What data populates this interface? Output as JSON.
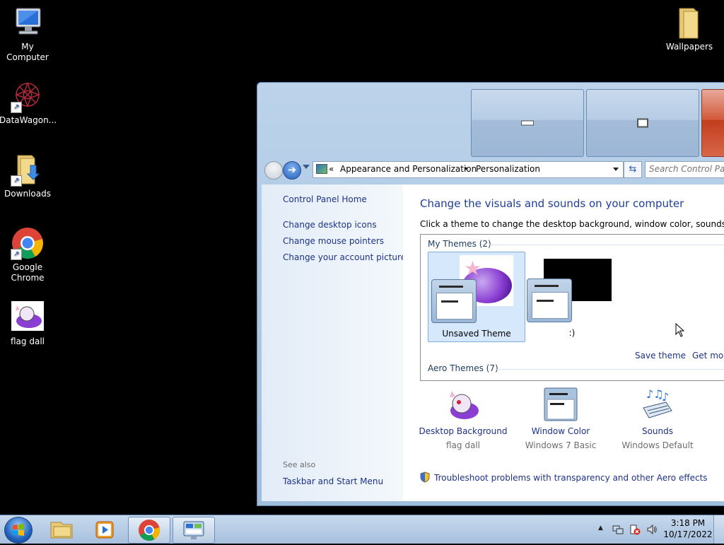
{
  "desktop": {
    "icons": [
      {
        "label": "My Computer",
        "icon": "computer-icon"
      },
      {
        "label": "DataWagon...",
        "icon": "datawagon-icon"
      },
      {
        "label": "Downloads",
        "icon": "folder-download-icon"
      },
      {
        "label": "Google Chrome",
        "icon": "chrome-icon"
      },
      {
        "label": "flag dall",
        "icon": "image-icon"
      },
      {
        "label": "Wallpapers",
        "icon": "folder-icon"
      }
    ]
  },
  "window": {
    "address": {
      "chevron": "«",
      "crumb1": "Appearance and Personalization",
      "separator": "▸",
      "crumb2": "Personalization"
    },
    "search": {
      "placeholder": "Search Control Panel"
    },
    "sidebar": {
      "home": "Control Panel Home",
      "links": [
        "Change desktop icons",
        "Change mouse pointers",
        "Change your account picture"
      ],
      "see_also": "See also",
      "see_also_links": [
        "Taskbar and Start Menu"
      ]
    },
    "main": {
      "heading": "Change the visuals and sounds on your computer",
      "subtext": "Click a theme to change the desktop background, window color, sounds, and screen saver all at once.",
      "my_themes_label": "My Themes (2)",
      "themes": [
        {
          "name": "Unsaved Theme",
          "selected": true
        },
        {
          "name": ":)",
          "selected": false
        }
      ],
      "save_theme": "Save theme",
      "get_more": "Get more themes online",
      "aero_label": "Aero Themes (7)",
      "bottom": [
        {
          "link": "Desktop Background",
          "sub": "flag dall",
          "icon": "wallpaper-icon"
        },
        {
          "link": "Window Color",
          "sub": "Windows 7 Basic",
          "icon": "window-color-icon"
        },
        {
          "link": "Sounds",
          "sub": "Windows Default",
          "icon": "sounds-icon"
        }
      ],
      "troubleshoot": "Troubleshoot problems with transparency and other Aero effects"
    }
  },
  "taskbar": {
    "time": "3:18 PM",
    "date": "10/17/2022",
    "items": [
      {
        "icon": "explorer-icon",
        "active": false
      },
      {
        "icon": "media-player-icon",
        "active": false
      },
      {
        "icon": "chrome-icon",
        "active": true
      },
      {
        "icon": "control-panel-icon",
        "active": true
      }
    ]
  },
  "colors": {
    "link": "#1e3287",
    "heading": "#1e3d9a",
    "desktop": "#000000"
  }
}
